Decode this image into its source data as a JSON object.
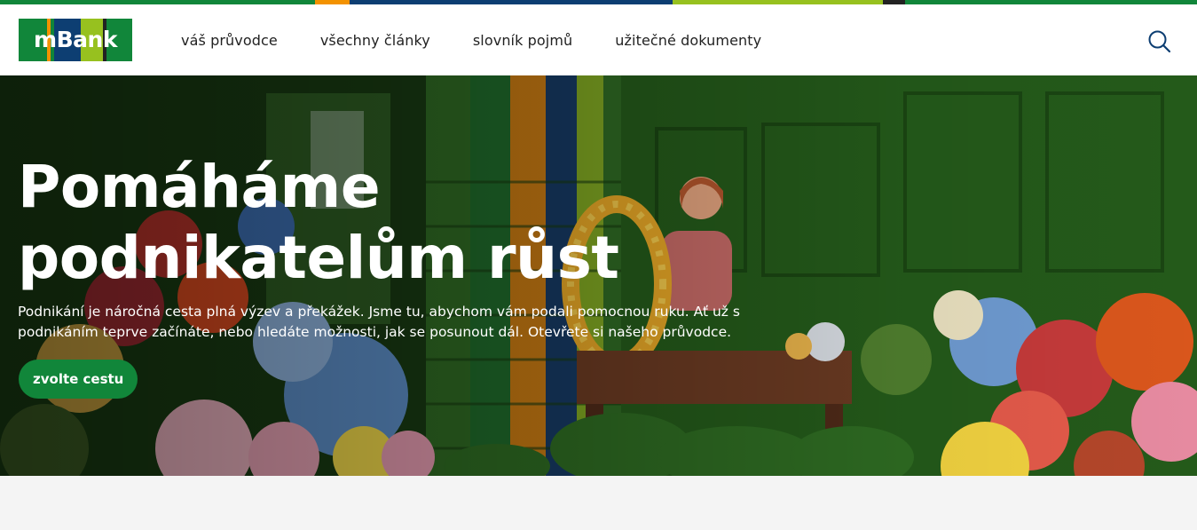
{
  "brand": {
    "logo_text": "mBank",
    "colors": {
      "green": "#11863a",
      "orange": "#f39200",
      "navy": "#0d3e72",
      "lime": "#97c11f",
      "dark": "#222222"
    }
  },
  "nav": {
    "items": [
      {
        "label": "váš průvodce"
      },
      {
        "label": "všechny články"
      },
      {
        "label": "slovník pojmů"
      },
      {
        "label": "užitečné dokumenty"
      }
    ],
    "search_icon": "search-icon"
  },
  "hero": {
    "title": "Pomáháme podnikatelům růst",
    "text": "Podnikání je náročná cesta plná výzev a překážek. Jsme tu, abychom vám podali pomocnou ruku. Ať už s podnikáním teprve začínáte, nebo hledáte možnosti, jak se posunout dál. Otevřete si našeho průvodce.",
    "cta_label": "zvolte cestu"
  }
}
